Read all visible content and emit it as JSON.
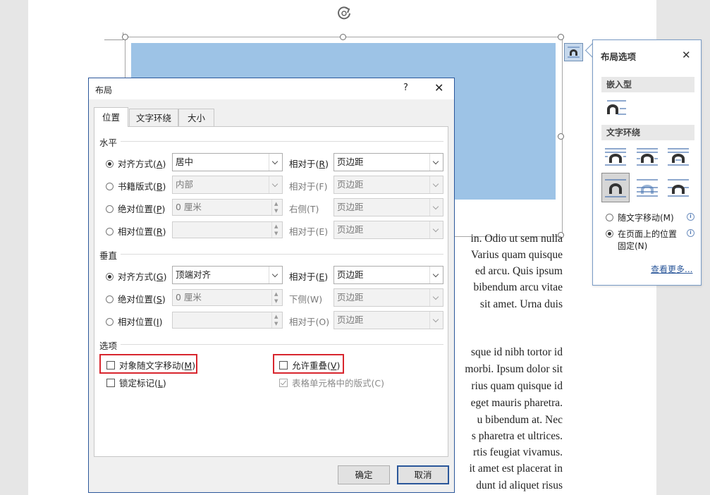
{
  "document": {
    "body_lines": [
      "in. Odio ut sem nulla",
      "Varius quam quisque",
      "ed arcu. Quis ipsum",
      "bibendum arcu vitae",
      "sit amet. Urna duis",
      "",
      "sque id nibh tortor id",
      "morbi. Ipsum dolor sit",
      "rius quam quisque id",
      "eget mauris pharetra.",
      "u bibendum at. Nec",
      "s pharetra et ultrices.",
      "rtis feugiat vivamus.",
      "it amet est placerat in",
      "dunt id aliquet risus"
    ]
  },
  "panel": {
    "title": "布局选项",
    "close": "✕",
    "inline_section": "嵌入型",
    "wrap_section": "文字环绕",
    "radio_move": "随文字移动(M)",
    "radio_fixed_line1": "在页面上的位置",
    "radio_fixed_line2": "固定(N)",
    "see_more": "查看更多...",
    "info": "i"
  },
  "dialog": {
    "title": "布局",
    "help": "?",
    "close": "✕",
    "tabs": [
      "位置",
      "文字环绕",
      "大小"
    ],
    "horizontal": {
      "section": "水平",
      "align_label": "对齐方式(",
      "align_key": "A",
      "align_value": "居中",
      "book_label": "书籍版式(",
      "book_key": "B",
      "book_value": "内部",
      "abs_label": "绝对位置(",
      "abs_key": "P",
      "abs_value": "0 厘米",
      "rel_label": "相对位置(",
      "rel_key": "R",
      "rel_value": "",
      "relative_to_R": "相对于(",
      "relative_to_R_key": "R",
      "relative_to_F": "相对于(F)",
      "right_of": "右侧(T)",
      "relative_to_E": "相对于(E)",
      "margin1": "页边距",
      "margin2": "页边距",
      "margin3": "页边距",
      "margin4": "页边距"
    },
    "vertical": {
      "section": "垂直",
      "align_label": "对齐方式(",
      "align_key": "G",
      "align_value": "顶端对齐",
      "abs_label": "绝对位置(",
      "abs_key": "S",
      "abs_value": "0 厘米",
      "rel_label": "相对位置(",
      "rel_key": "I",
      "rel_value": "",
      "relative_to_E": "相对于(",
      "relative_to_E_key": "E",
      "below": "下侧(W)",
      "relative_to_O": "相对于(O)",
      "margin1": "页边距",
      "margin2": "页边距",
      "margin3": "页边距"
    },
    "options": {
      "section": "选项",
      "move_with_text_label": "对象随文字移动(",
      "move_with_text_key": "M",
      "lock_anchor_label": "锁定标记(",
      "lock_anchor_key": "L",
      "allow_overlap_label": "允许重叠(",
      "allow_overlap_key": "V",
      "table_cell_layout": "表格单元格中的版式(C)"
    },
    "ok": "确定",
    "cancel": "取消"
  },
  "colors": {
    "picture": "#9dc3e6",
    "accent": "#2b579a",
    "highlight": "#d8262e"
  }
}
